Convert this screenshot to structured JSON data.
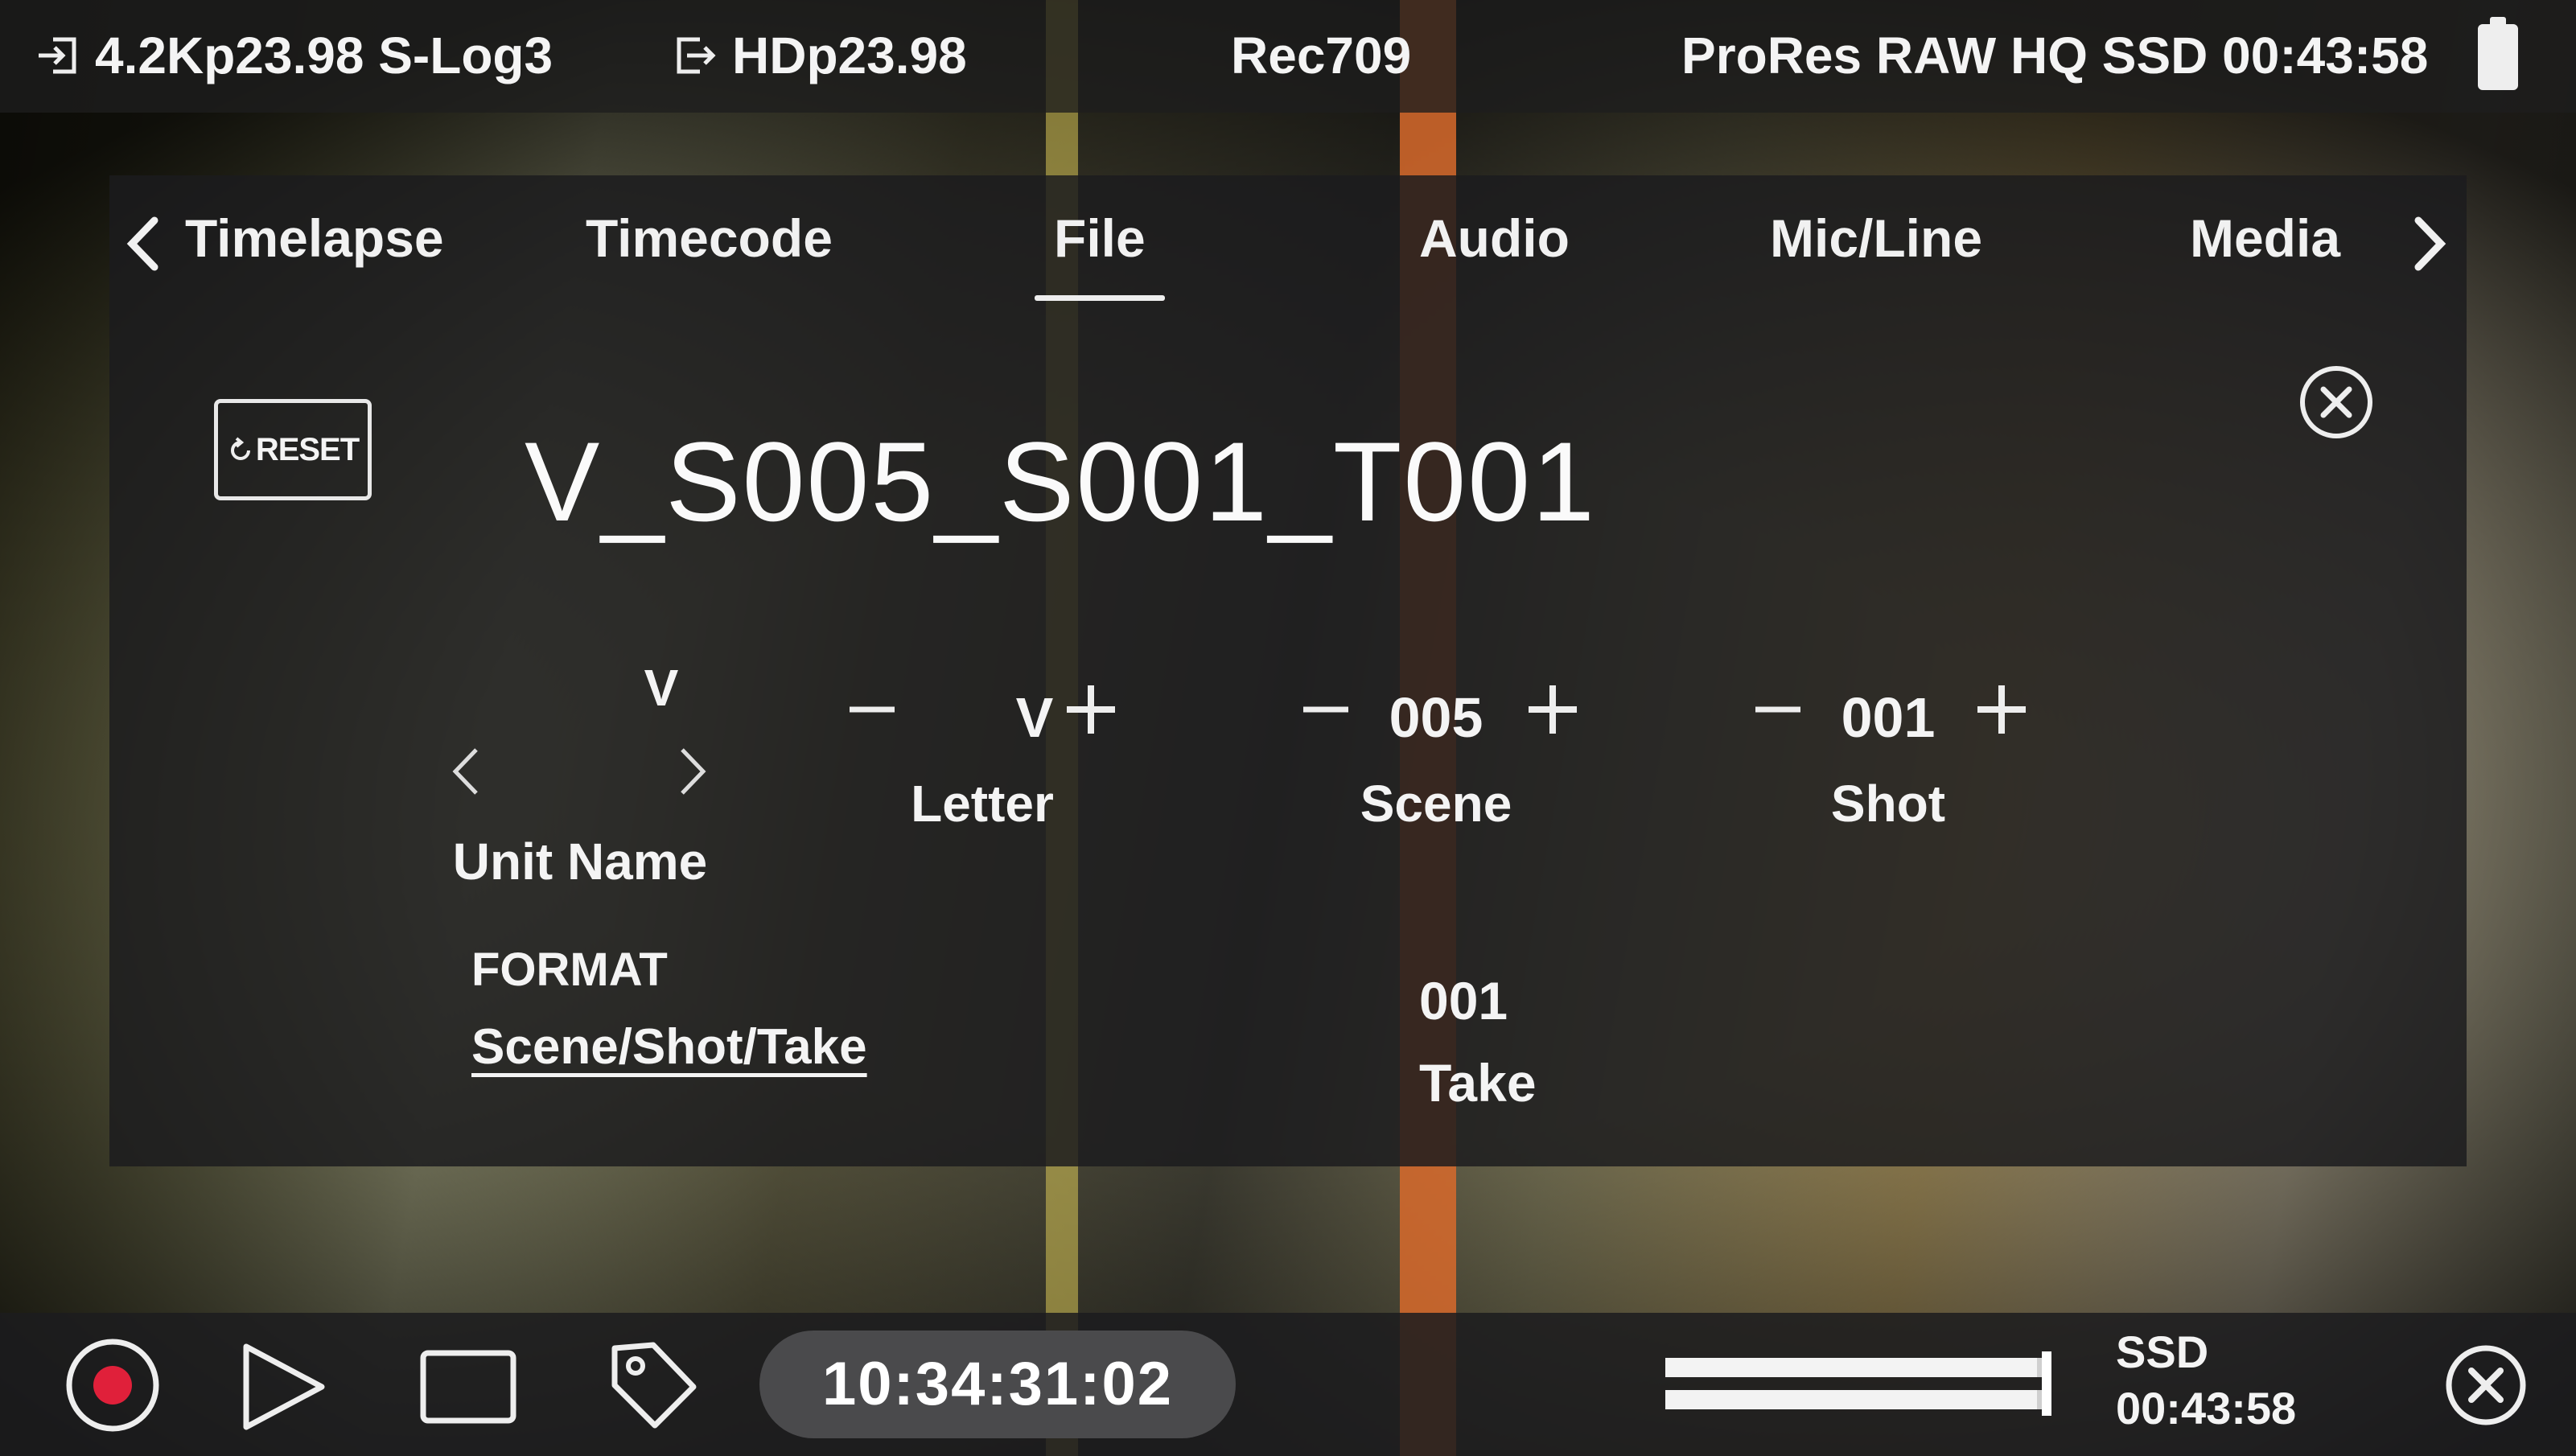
{
  "status_bar": {
    "input_format": "4.2Kp23.98 S-Log3",
    "output_format": "HDp23.98",
    "lut": "Rec709",
    "record_info": "ProRes RAW HQ SSD 00:43:58"
  },
  "tabs": [
    {
      "label": "Timelapse",
      "active": false
    },
    {
      "label": "Timecode",
      "active": false
    },
    {
      "label": "File",
      "active": true
    },
    {
      "label": "Audio",
      "active": false
    },
    {
      "label": "Mic/Line",
      "active": false
    },
    {
      "label": "Media",
      "active": false
    }
  ],
  "file_panel": {
    "reset_label": "RESET",
    "filename": "V_S005_S001_T001",
    "unit_name": {
      "value": "V",
      "label": "Unit Name"
    },
    "letter": {
      "value": "V",
      "label": "Letter"
    },
    "scene": {
      "value": "005",
      "label": "Scene"
    },
    "shot": {
      "value": "001",
      "label": "Shot"
    },
    "format": {
      "label": "FORMAT",
      "value": "Scene/Shot/Take"
    },
    "take": {
      "value": "001",
      "label": "Take"
    }
  },
  "bottom_bar": {
    "timecode": "10:34:31:02",
    "media_name": "SSD",
    "media_remaining": "00:43:58",
    "audio_levels": [
      0.97,
      0.97
    ]
  },
  "colors": {
    "record_red": "#e0203a",
    "panel_bg": "#1c1c1e",
    "text": "#f4f4f4"
  },
  "icons": [
    "input-icon",
    "output-icon",
    "battery-icon",
    "chevron-left-icon",
    "chevron-right-icon",
    "reset-icon",
    "close-icon",
    "minus-icon",
    "plus-icon",
    "record-icon",
    "play-icon",
    "stop-icon",
    "tag-icon"
  ]
}
